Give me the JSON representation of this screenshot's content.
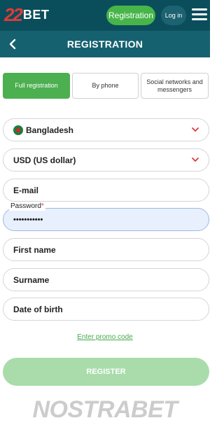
{
  "brand": {
    "logo_number": "22",
    "logo_text": "BET"
  },
  "topbar": {
    "registration_label": "Registration",
    "login_label": "Log in"
  },
  "header": {
    "title": "REGISTRATION"
  },
  "tabs": [
    {
      "label": "Full registration",
      "active": true
    },
    {
      "label": "By phone",
      "active": false
    },
    {
      "label": "Social networks and messengers",
      "active": false
    }
  ],
  "form": {
    "country": "Bangladesh",
    "currency": "USD (US dollar)",
    "email_placeholder": "E-mail",
    "password_label": "Password",
    "password_required_mark": "*",
    "password_value": "•••••••••••",
    "first_name_placeholder": "First name",
    "surname_placeholder": "Surname",
    "dob_placeholder": "Date of birth",
    "promo_link": "Enter promo code",
    "register_label": "REGISTER"
  },
  "watermark": "NOSTRABET",
  "colors": {
    "topbar": "#0b4e5b",
    "header": "#166170",
    "accent_green": "#47b54a",
    "register_disabled": "#a9dcaa",
    "logo_red": "#e03a3a"
  },
  "icons": [
    "back-arrow-icon",
    "menu-icon",
    "chevron-down-icon",
    "flag-icon"
  ]
}
